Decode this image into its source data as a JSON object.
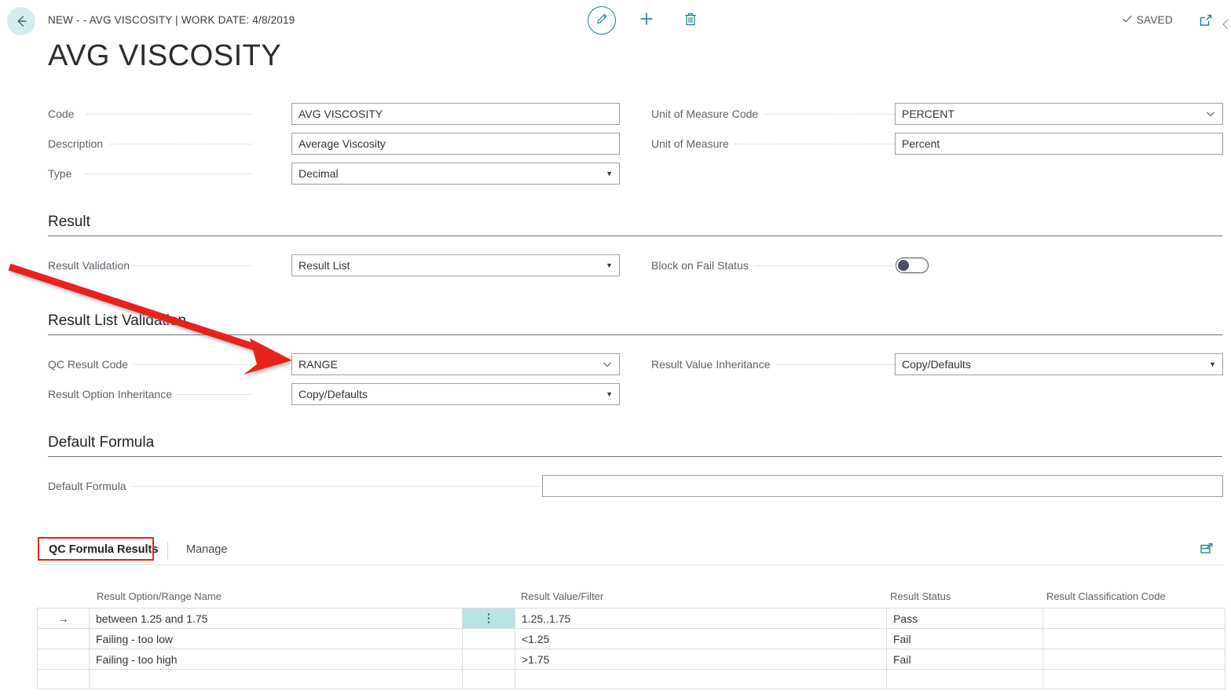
{
  "header": {
    "back_icon": "back-arrow-icon",
    "breadcrumb": "NEW - - AVG VISCOSITY | WORK DATE: 4/8/2019",
    "edit_icon": "pencil-icon",
    "new_icon": "plus-icon",
    "delete_icon": "trash-icon",
    "saved_label": "SAVED",
    "saved_check": "check-icon",
    "open_new_icon": "open-in-new-window-icon"
  },
  "page_title": "AVG VISCOSITY",
  "general": {
    "fields": [
      {
        "label": "Code",
        "value": "AVG VISCOSITY",
        "control": "text"
      },
      {
        "label": "Description",
        "value": "Average Viscosity",
        "control": "text"
      },
      {
        "label": "Type",
        "value": "Decimal",
        "control": "dropdown"
      }
    ],
    "fields_right": [
      {
        "label": "Unit of Measure Code",
        "value": "PERCENT",
        "control": "lookup"
      },
      {
        "label": "Unit of Measure",
        "value": "Percent",
        "control": "text"
      }
    ]
  },
  "result_section": {
    "title": "Result",
    "fields": [
      {
        "label": "Result Validation",
        "value": "Result List",
        "control": "dropdown"
      }
    ],
    "fields_right": [
      {
        "label": "Block on Fail Status",
        "value": "",
        "control": "toggle",
        "toggle_on": false
      }
    ]
  },
  "result_list_section": {
    "title": "Result List Validation",
    "fields": [
      {
        "label": "QC Result Code",
        "value": "RANGE",
        "control": "lookup"
      },
      {
        "label": "Result Option Inheritance",
        "value": "Copy/Defaults",
        "control": "dropdown"
      }
    ],
    "fields_right": [
      {
        "label": "Result Value Inheritance",
        "value": "Copy/Defaults",
        "control": "dropdown"
      }
    ]
  },
  "default_formula_section": {
    "title": "Default Formula",
    "fields": [
      {
        "label": "Default Formula",
        "value": "",
        "control": "text"
      }
    ]
  },
  "tabs": {
    "active": "QC Formula Results",
    "manage": "Manage",
    "expand_icon": "expand-grid-icon"
  },
  "grid": {
    "columns": [
      "Result Option/Range Name",
      "Result Value/Filter",
      "Result Status",
      "Result Classification Code"
    ],
    "rows": [
      {
        "selected": true,
        "row_indicator": "→",
        "name": "between 1.25 and 1.75",
        "value_filter": "1.25..1.75",
        "status": "Pass",
        "classification": ""
      },
      {
        "selected": false,
        "row_indicator": "",
        "name": "Failing - too low",
        "value_filter": "<1.25",
        "status": "Fail",
        "classification": ""
      },
      {
        "selected": false,
        "row_indicator": "",
        "name": "Failing - too high",
        "value_filter": ">1.75",
        "status": "Fail",
        "classification": ""
      },
      {
        "selected": false,
        "row_indicator": "",
        "name": "",
        "value_filter": "",
        "status": "",
        "classification": ""
      }
    ]
  },
  "annotations": {
    "arrow_color": "#e8201a",
    "highlight_color": "#e8201a",
    "arrow_target": "QC Result Code field",
    "highlight_target": "QC Formula Results tab"
  },
  "colors": {
    "accent_teal": "#17808e",
    "back_circle": "#d6edef",
    "selected_cell": "#b7e4e6",
    "label_gray": "#5a6169",
    "border_gray": "#9aa0a6"
  }
}
